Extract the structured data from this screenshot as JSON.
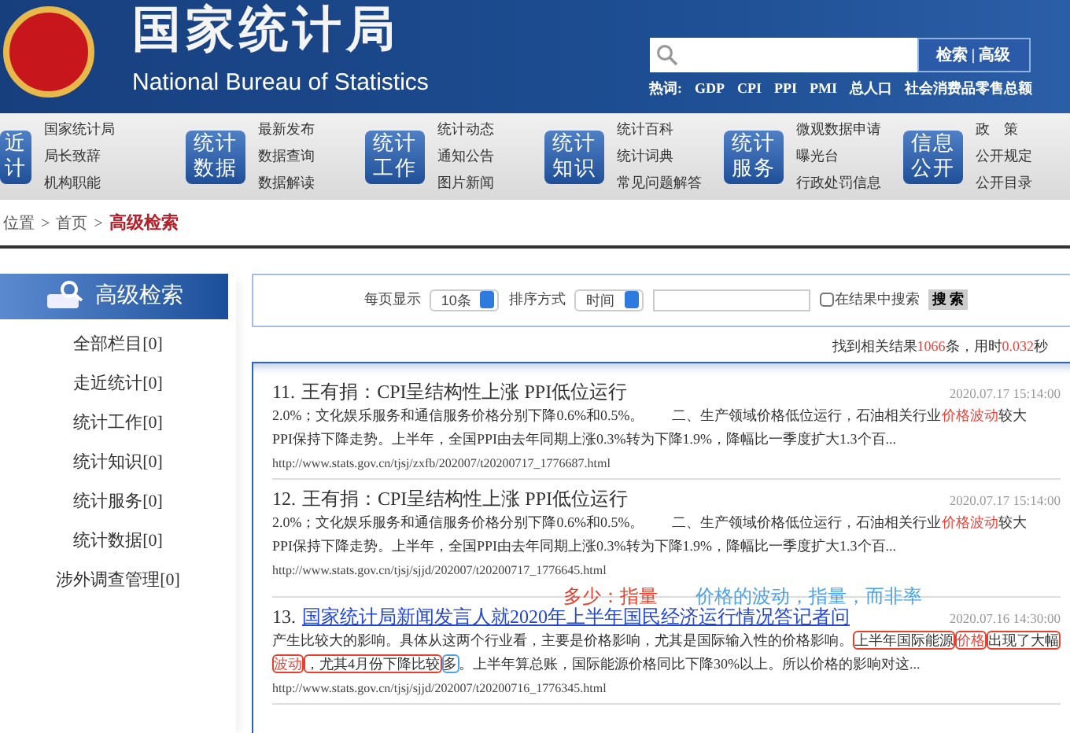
{
  "header": {
    "title": "国家统计局",
    "subtitle": "National Bureau of Statistics",
    "search": {
      "button": "检索 | 高级"
    },
    "hotwords_label": "热词:",
    "hotwords": [
      "GDP",
      "CPI",
      "PPI",
      "PMI",
      "总人口",
      "社会消费品零售总额"
    ]
  },
  "nav": [
    {
      "badge": [
        "近",
        "计"
      ],
      "links": [
        "国家统计局",
        "局长致辞",
        "机构职能"
      ]
    },
    {
      "badge": [
        "统计",
        "数据"
      ],
      "links": [
        "最新发布",
        "数据查询",
        "数据解读"
      ]
    },
    {
      "badge": [
        "统计",
        "工作"
      ],
      "links": [
        "统计动态",
        "通知公告",
        "图片新闻"
      ]
    },
    {
      "badge": [
        "统计",
        "知识"
      ],
      "links": [
        "统计百科",
        "统计词典",
        "常见问题解答"
      ]
    },
    {
      "badge": [
        "统计",
        "服务"
      ],
      "links": [
        "微观数据申请",
        "曝光台",
        "行政处罚信息"
      ]
    },
    {
      "badge": [
        "信息",
        "公开"
      ],
      "links": [
        "政　策",
        "公开规定",
        "公开目录"
      ]
    }
  ],
  "breadcrumb": {
    "separator": ">",
    "items": [
      {
        "label": "位置",
        "current": false
      },
      {
        "label": "首页",
        "current": false
      },
      {
        "label": "高级检索",
        "current": true
      }
    ]
  },
  "sidebar": {
    "title": "高级检索",
    "items": [
      "全部栏目[0]",
      "走近统计[0]",
      "统计工作[0]",
      "统计知识[0]",
      "统计服务[0]",
      "统计数据[0]",
      "涉外调查管理[0]"
    ]
  },
  "filter": {
    "per_page_label": "每页显示",
    "per_page": "10条",
    "sort_label": "排序方式",
    "sort": "时间",
    "within_results": {
      "label": "在结果中搜索",
      "checked": false
    },
    "button": "搜 索"
  },
  "summary": [
    {
      "text": "找到相关结果",
      "highlight": false
    },
    {
      "text": "1066",
      "highlight": true
    },
    {
      "text": "条，用时",
      "highlight": false
    },
    {
      "text": "0.032",
      "highlight": true
    },
    {
      "text": "秒",
      "highlight": false
    }
  ],
  "results": [
    {
      "number": "11.",
      "title": "王有捐：CPI呈结构性上涨 PPI低位运行",
      "linked": false,
      "date": "2020.07.17 15:14:00",
      "lines": [
        [
          {
            "text": "2.0%；文化娱乐服务和通信服务价格分别下降0.6%和0.5%。　　二、生产领域价格低位运行，石油相关行业",
            "highlight": false,
            "kind": "plain"
          },
          {
            "text": "价格波动",
            "highlight": true,
            "kind": "plain"
          },
          {
            "text": "较大",
            "highlight": false,
            "kind": "plain"
          }
        ],
        [
          {
            "text": "PPI保持下降走势。上半年，全国PPI由去年同期上涨0.3%转为下降1.9%，降幅比一季度扩大1.3个百...",
            "highlight": false,
            "kind": "plain"
          }
        ]
      ],
      "url": "http://www.stats.gov.cn/tjsj/zxfb/202007/t20200717_1776687.html"
    },
    {
      "number": "12.",
      "title": "王有捐：CPI呈结构性上涨 PPI低位运行",
      "linked": false,
      "date": "2020.07.17 15:14:00",
      "lines": [
        [
          {
            "text": "2.0%；文化娱乐服务和通信服务价格分别下降0.6%和0.5%。　　二、生产领域价格低位运行，石油相关行业",
            "highlight": false,
            "kind": "plain"
          },
          {
            "text": "价格波动",
            "highlight": true,
            "kind": "plain"
          },
          {
            "text": "较大",
            "highlight": false,
            "kind": "plain"
          }
        ],
        [
          {
            "text": "PPI保持下降走势。上半年，全国PPI由去年同期上涨0.3%转为下降1.9%，降幅比一季度扩大1.3个百...",
            "highlight": false,
            "kind": "plain"
          }
        ]
      ],
      "url": "http://www.stats.gov.cn/tjsj/sjjd/202007/t20200717_1776645.html",
      "notes": [
        {
          "text": "多少：指量",
          "color": "#e8402c"
        },
        {
          "text": "价格的波动，指量，而非率",
          "color": "#4aa3e8"
        }
      ]
    },
    {
      "number": "13.",
      "title": "国家统计局新闻发言人就2020年上半年国民经济运行情况答记者问",
      "linked": true,
      "date": "2020.07.16 14:30:00",
      "lines": [
        [
          {
            "text": "产生比较大的影响。具体从这两个行业看，主要是价格影响，尤其是国际输入性的价格影响。",
            "highlight": false,
            "kind": "plain"
          },
          {
            "text": "上半年国际能源",
            "highlight": false,
            "kind": "redbox"
          },
          {
            "text": "价格",
            "highlight": true,
            "kind": "redbox"
          },
          {
            "text": "出现了大幅",
            "highlight": false,
            "kind": "redbox"
          }
        ],
        [
          {
            "text": "波动",
            "highlight": true,
            "kind": "redbox"
          },
          {
            "text": "，尤其4月份下降比较",
            "highlight": false,
            "kind": "redbox"
          },
          {
            "text": "多",
            "highlight": false,
            "kind": "bluebox"
          },
          {
            "text": "。上半年算总账，国际能源价格同比下降30%以上。所以价格的影响对这...",
            "highlight": false,
            "kind": "plain"
          }
        ]
      ],
      "url": "http://www.stats.gov.cn/tjsj/sjjd/202007/t20200716_1776345.html"
    }
  ]
}
